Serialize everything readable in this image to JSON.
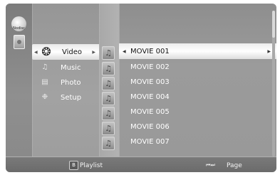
{
  "devices": {
    "disc_label": "Nodisc"
  },
  "categories": [
    {
      "label": "Video",
      "icon": "film-reel-icon"
    },
    {
      "label": "Music",
      "icon": "music-note-icon"
    },
    {
      "label": "Photo",
      "icon": "photo-icon"
    },
    {
      "label": "Setup",
      "icon": "gear-icon"
    }
  ],
  "movies": [
    "MOVIE 001",
    "MOVIE 002",
    "MOVIE 003",
    "MOVIE 004",
    "MOVIE 005",
    "MOVIE 006",
    "MOVIE 007"
  ],
  "footer": {
    "playlist_key": "B",
    "playlist_label": "Playlist",
    "page_label": "Page"
  }
}
